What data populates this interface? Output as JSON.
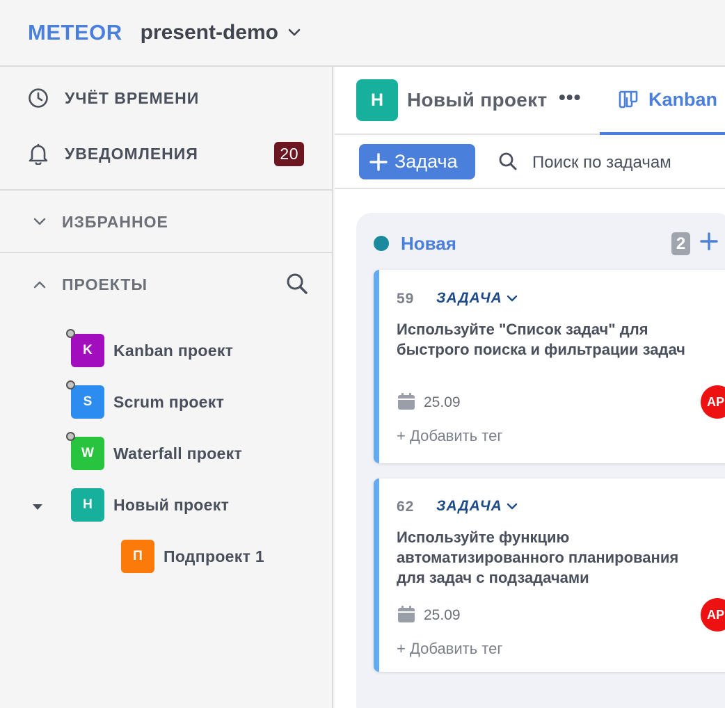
{
  "app": {
    "logo": "METEOR",
    "workspace": "present-demo"
  },
  "sidebar": {
    "time_tracking": "УЧЁТ ВРЕМЕНИ",
    "notifications": "УВЕДОМЛЕНИЯ",
    "notifications_count": "20",
    "favorites": "ИЗБРАННОЕ",
    "projects": "ПРОЕКТЫ",
    "project_list": [
      {
        "letter": "K",
        "name": "Kanban проект",
        "color": "#a20dbd"
      },
      {
        "letter": "S",
        "name": "Scrum проект",
        "color": "#2d8cf0"
      },
      {
        "letter": "W",
        "name": "Waterfall проект",
        "color": "#28c43f"
      },
      {
        "letter": "Н",
        "name": "Новый проект",
        "color": "#17b09d"
      },
      {
        "letter": "П",
        "name": "Подпроект 1",
        "color": "#fb7a09"
      }
    ]
  },
  "project": {
    "letter": "Н",
    "name": "Новый проект",
    "more": "•••",
    "view_tab": "Kanban"
  },
  "toolbar": {
    "add_task": "Задача",
    "search_placeholder": "Поиск по задачам"
  },
  "column": {
    "title": "Новая",
    "count": "2",
    "cards": [
      {
        "number": "59",
        "type": "ЗАДАЧА",
        "title_lines": [
          "Используйте \"Список задач\" для",
          "быстрого поиска и фильтрации задач"
        ],
        "date": "25.09",
        "add_tag": "+ Добавить тег",
        "avatar": "AP"
      },
      {
        "number": "62",
        "type": "ЗАДАЧА",
        "title_lines": [
          "Используйте функцию",
          "автоматизированного планирования",
          "для задач с подзадачами"
        ],
        "date": "25.09",
        "add_tag": "+ Добавить тег",
        "avatar": "AP"
      }
    ]
  },
  "colors": {
    "accent": "#4a7fdc",
    "badge": "#6b1620",
    "card_border": "#64aaf3",
    "status_dot": "#1b8a9e",
    "avatar": "#ee1111"
  }
}
